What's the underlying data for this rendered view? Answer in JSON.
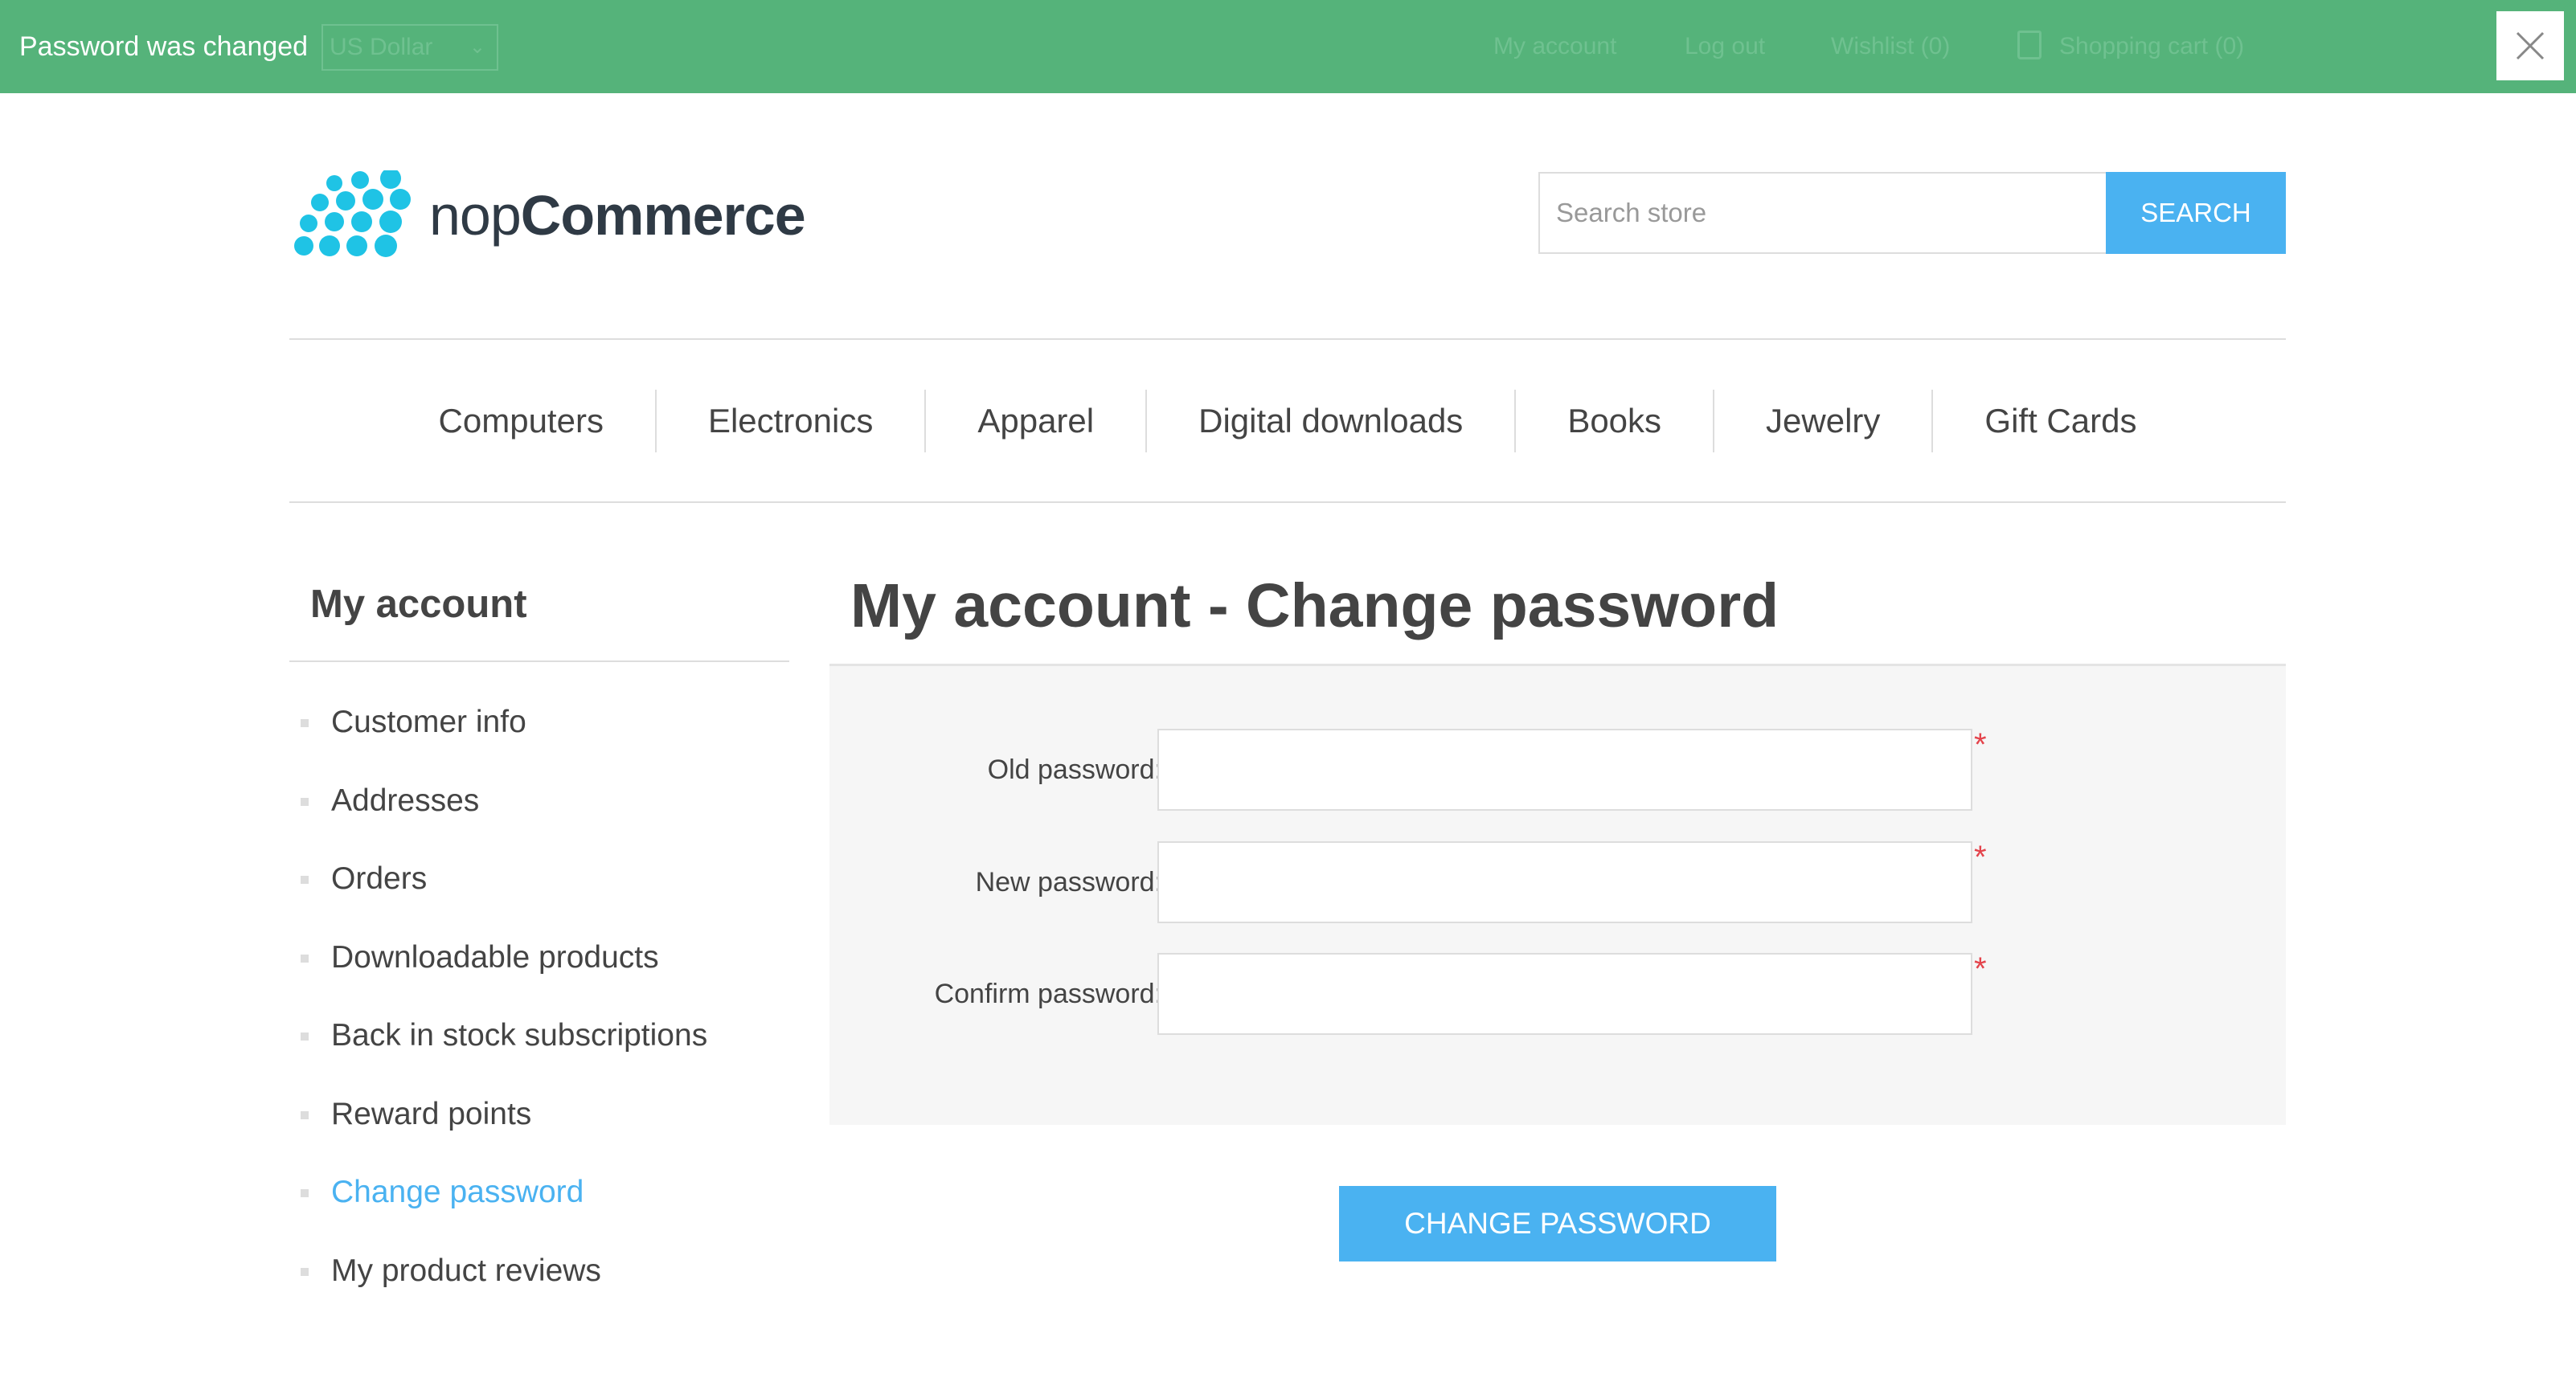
{
  "notification": {
    "message": "Password was changed",
    "close_icon": "close-icon",
    "background": "#55b37a"
  },
  "header_links_behind_bar": {
    "currency": "US Dollar",
    "my_account": "My account",
    "log_out": "Log out",
    "wishlist": "Wishlist (0)",
    "shopping_cart": "Shopping cart (0)"
  },
  "logo": {
    "brand_light": "nop",
    "brand_bold": "Commerce",
    "accent": "#1fc3e5"
  },
  "search": {
    "placeholder": "Search store",
    "button_label": "SEARCH",
    "accent": "#4ab2f1"
  },
  "top_menu": {
    "items": [
      {
        "label": "Computers"
      },
      {
        "label": "Electronics"
      },
      {
        "label": "Apparel"
      },
      {
        "label": "Digital downloads"
      },
      {
        "label": "Books"
      },
      {
        "label": "Jewelry"
      },
      {
        "label": "Gift Cards"
      }
    ]
  },
  "side_nav": {
    "title": "My account",
    "items": [
      {
        "label": "Customer info",
        "active": false
      },
      {
        "label": "Addresses",
        "active": false
      },
      {
        "label": "Orders",
        "active": false
      },
      {
        "label": "Downloadable products",
        "active": false
      },
      {
        "label": "Back in stock subscriptions",
        "active": false
      },
      {
        "label": "Reward points",
        "active": false
      },
      {
        "label": "Change password",
        "active": true
      },
      {
        "label": "My product reviews",
        "active": false
      }
    ]
  },
  "main": {
    "title": "My account - Change password",
    "fields": [
      {
        "label": "Old password:",
        "value": "",
        "required_mark": "*"
      },
      {
        "label": "New password:",
        "value": "",
        "required_mark": "*"
      },
      {
        "label": "Confirm password:",
        "value": "",
        "required_mark": "*"
      }
    ],
    "submit_label": "CHANGE PASSWORD"
  }
}
